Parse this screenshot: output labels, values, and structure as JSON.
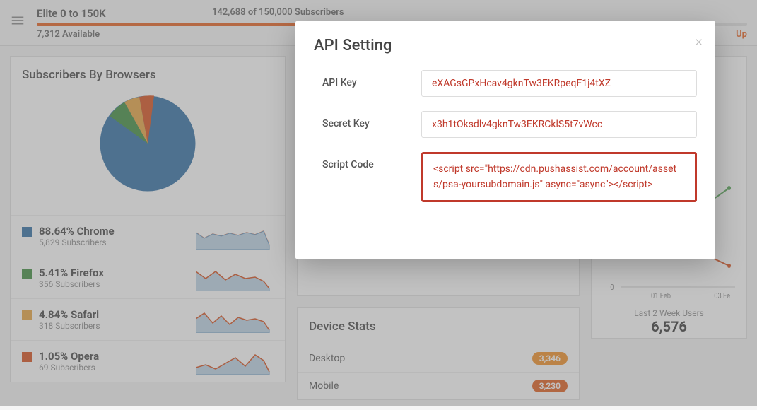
{
  "topbar": {
    "plan_title": "Elite 0 to 150K",
    "usage": "142,688 of 150,000 Subscribers",
    "available": "7,312 Available",
    "upgrade": "Up"
  },
  "browsers_card": {
    "title": "Subscribers By Browsers"
  },
  "browsers": [
    {
      "swatch_color": "#2d6ca2",
      "name": "88.64% Chrome",
      "sub": "5,829 Subscribers"
    },
    {
      "swatch_color": "#3b8b3b",
      "name": "5.41% Firefox",
      "sub": "356 Subscribers"
    },
    {
      "swatch_color": "#e8a33d",
      "name": "4.84% Safari",
      "sub": "318 Subscribers"
    },
    {
      "swatch_color": "#d84b16",
      "name": "1.05% Opera",
      "sub": "69 Subscribers"
    }
  ],
  "device_stats": {
    "title": "Device Stats",
    "rows": [
      {
        "label": "Desktop",
        "value": "3,346"
      },
      {
        "label": "Mobile",
        "value": "3,230"
      }
    ]
  },
  "right_chart": {
    "y_tick": "0",
    "x_ticks": [
      "01 Feb",
      "03 Fe"
    ],
    "footer_label": "Last 2 Week Users",
    "footer_value": "6,576"
  },
  "modal": {
    "title": "API Setting",
    "rows": {
      "api_key_label": "API Key",
      "api_key_value": "eXAGsGPxHcav4gknTw3EKRpeqF1j4tXZ",
      "secret_label": "Secret Key",
      "secret_value": "x3h1tOksdlv4gknTw3EKRCklS5t7vWcc",
      "script_label": "Script Code",
      "script_value": "<script src=\"https://cdn.pushassist.com/account/assets/psa-yoursubdomain.js\" async=\"async\"></script>"
    }
  },
  "chart_data": {
    "type": "pie",
    "title": "Subscribers By Browsers",
    "categories": [
      "Chrome",
      "Firefox",
      "Safari",
      "Opera"
    ],
    "values": [
      88.64,
      5.41,
      4.84,
      1.05
    ],
    "colors": [
      "#2d6ca2",
      "#3b8b3b",
      "#e8a33d",
      "#d84b16"
    ]
  }
}
